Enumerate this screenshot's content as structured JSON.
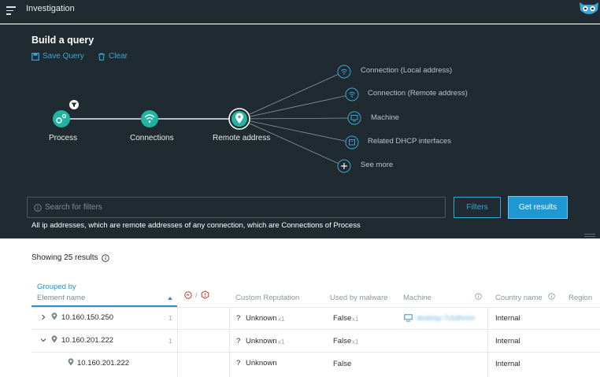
{
  "app": {
    "title": "Investigation"
  },
  "builder": {
    "title": "Build a query",
    "save_label": "Save Query",
    "clear_label": "Clear",
    "nodes": [
      "Process",
      "Connections",
      "Remote address"
    ],
    "targets": [
      "Connection (Local address)",
      "Connection (Remote address)",
      "Machine",
      "Related DHCP interfaces",
      "See more"
    ]
  },
  "search": {
    "placeholder": "Search for filters"
  },
  "buttons": {
    "filters": "Filters",
    "get_results": "Get results"
  },
  "description": "All ip addresses, which are remote addresses of any connection, which are Connections of Process",
  "results": {
    "showing": "Showing 25 results",
    "grouped_by": "Grouped by",
    "group_column": "Element name",
    "malware_separator": "/",
    "columns": [
      "Custom Reputation",
      "Used by malware",
      "Machine",
      "Country name",
      "Region"
    ],
    "rows": [
      {
        "name": "10.160.150.250",
        "count": "1",
        "reputation": "Unknown",
        "rep_count": "x1",
        "malware": "False",
        "malware_count": "x1",
        "machine": "desktop-7c6dhmm",
        "country": "Internal"
      },
      {
        "name": "10.160.201.222",
        "count": "1",
        "reputation": "Unknown",
        "rep_count": "x1",
        "malware": "False",
        "malware_count": "x1",
        "machine": "",
        "country": "Internal"
      },
      {
        "name": "10.160.201.222",
        "count": "",
        "reputation": "Unknown",
        "rep_count": "",
        "malware": "False",
        "malware_count": "",
        "machine": "",
        "country": "Internal"
      }
    ]
  },
  "colors": {
    "accent": "#1f97d2",
    "node": "#22b3a4",
    "dark_bg": "#1f2b30"
  }
}
